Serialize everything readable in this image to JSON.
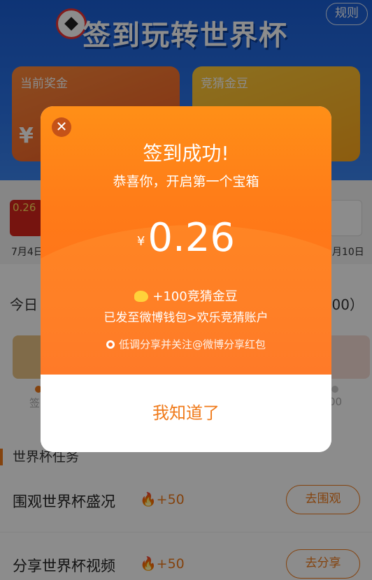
{
  "header": {
    "rules_label": "规则",
    "title": "签到玩转世界杯",
    "cards": [
      {
        "label": "当前奖金",
        "amount": "¥ 0"
      },
      {
        "label": "竞猜金豆",
        "amount": ""
      }
    ]
  },
  "signin": {
    "first_amount": "0.26",
    "first_date": "7月4日",
    "last_date": "7月10日",
    "today_label": "今日",
    "today_right": "00）",
    "chest_left_caption": "签",
    "chest_right_caption": "00"
  },
  "tasks": {
    "section_title": "世界杯任务",
    "items": [
      {
        "name": "围观世界杯盛况",
        "reward": "+50",
        "button": "去围观"
      },
      {
        "name": "分享世界杯视频",
        "reward": "+50",
        "button": "去分享"
      }
    ]
  },
  "modal": {
    "close_symbol": "✕",
    "title": "签到成功!",
    "subtitle": "恭喜你，开启第一个宝箱",
    "currency": "¥",
    "amount": "0.26",
    "beans_text": "+100竞猜金豆",
    "wallet_text": "已发至微博钱包>欢乐竞猜账户",
    "share_text": "低调分享并关注@微博分享红包",
    "confirm_label": "我知道了"
  },
  "colors": {
    "banner_blue": "#1b5fd6",
    "modal_orange": "#ff7a18",
    "accent_orange": "#f07a1a"
  }
}
